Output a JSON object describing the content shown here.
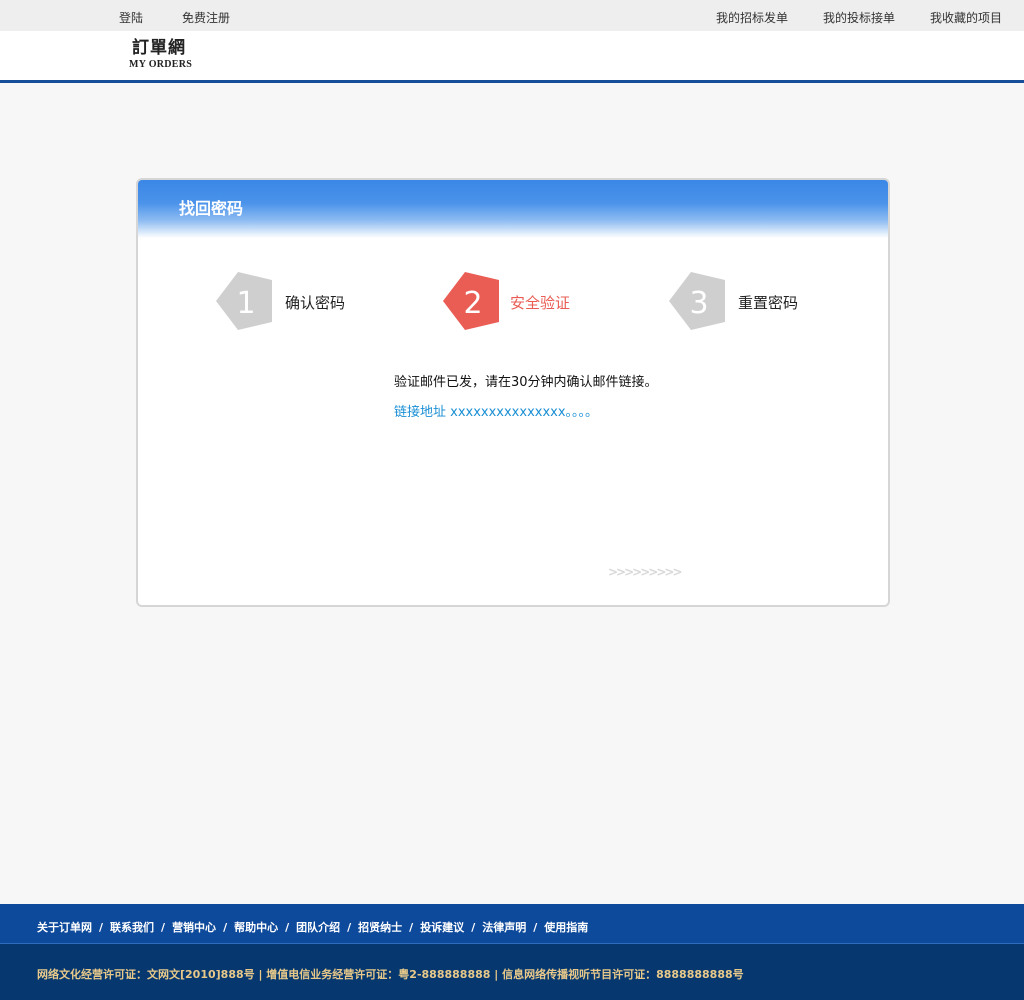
{
  "topbar": {
    "login": "登陆",
    "register": "免费注册",
    "my_tenders": "我的招标发单",
    "my_bids": "我的投标接单",
    "my_favorites": "我收藏的项目"
  },
  "logo": {
    "cn": "訂單網",
    "en": "MY ORDERS"
  },
  "card": {
    "title": "找回密码",
    "steps": [
      {
        "number": "1",
        "label": "确认密码",
        "state": "done",
        "color": "#cfcfcf"
      },
      {
        "number": "2",
        "label": "安全验证",
        "state": "active",
        "color": "#e95d55"
      },
      {
        "number": "3",
        "label": "重置密码",
        "state": "pending",
        "color": "#cfcfcf"
      }
    ],
    "message": "验证邮件已发，请在30分钟内确认邮件链接。",
    "link_label": "链接地址 xxxxxxxxxxxxxxx。。。。",
    "more_arrows": ">>>>>>>>>"
  },
  "footer": {
    "nav": [
      "关于订单网",
      "联系我们",
      "营销中心",
      "帮助中心",
      "团队介绍",
      "招贤纳士",
      "投诉建议",
      "法律声明",
      "使用指南"
    ],
    "separator": "/",
    "license": "网络文化经营许可证：文网文[2010]888号 | 增值电信业务经营许可证：粤2-888888888 | 信息网络传播视听节目许可证：8888888888号"
  },
  "colors": {
    "header_border": "#164e9a",
    "active_step": "#e95d55",
    "link": "#1a8fd4",
    "footer_nav_bg": "#0e4a9b",
    "footer_license_bg": "#06386f",
    "footer_license_text": "#e8c98a"
  }
}
